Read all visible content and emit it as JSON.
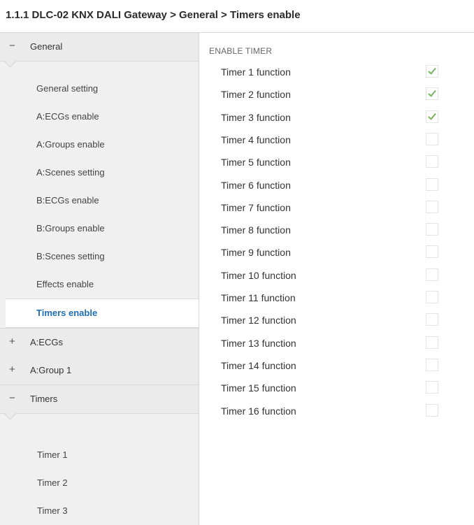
{
  "header": {
    "breadcrumb": "1.1.1 DLC-02 KNX DALI Gateway > General > Timers enable"
  },
  "sidebar": {
    "groups": [
      {
        "sign": "−",
        "label": "General"
      },
      {
        "sign": "+",
        "label": "A:ECGs"
      },
      {
        "sign": "+",
        "label": "A:Group 1"
      },
      {
        "sign": "−",
        "label": "Timers"
      }
    ],
    "general_items": [
      {
        "label": "General setting"
      },
      {
        "label": "A:ECGs enable"
      },
      {
        "label": "A:Groups enable"
      },
      {
        "label": "A:Scenes setting"
      },
      {
        "label": "B:ECGs enable"
      },
      {
        "label": "B:Groups enable"
      },
      {
        "label": "B:Scenes setting"
      },
      {
        "label": "Effects enable"
      },
      {
        "label": "Timers enable"
      }
    ],
    "timer_items": [
      {
        "label": "Timer 1"
      },
      {
        "label": "Timer 2"
      },
      {
        "label": "Timer 3"
      }
    ]
  },
  "main": {
    "section_title": "ENABLE TIMER",
    "timers": [
      {
        "label": "Timer 1 function",
        "checked": true
      },
      {
        "label": "Timer 2 function",
        "checked": true
      },
      {
        "label": "Timer 3 function",
        "checked": true
      },
      {
        "label": "Timer 4 function",
        "checked": false
      },
      {
        "label": "Timer 5 function",
        "checked": false
      },
      {
        "label": "Timer 6 function",
        "checked": false
      },
      {
        "label": "Timer 7 function",
        "checked": false
      },
      {
        "label": "Timer 8 function",
        "checked": false
      },
      {
        "label": "Timer 9 function",
        "checked": false
      },
      {
        "label": "Timer 10 function",
        "checked": false
      },
      {
        "label": "Timer 11 function",
        "checked": false
      },
      {
        "label": "Timer 12 function",
        "checked": false
      },
      {
        "label": "Timer 13 function",
        "checked": false
      },
      {
        "label": "Timer 14 function",
        "checked": false
      },
      {
        "label": "Timer 15 function",
        "checked": false
      },
      {
        "label": "Timer 16 function",
        "checked": false
      }
    ]
  }
}
